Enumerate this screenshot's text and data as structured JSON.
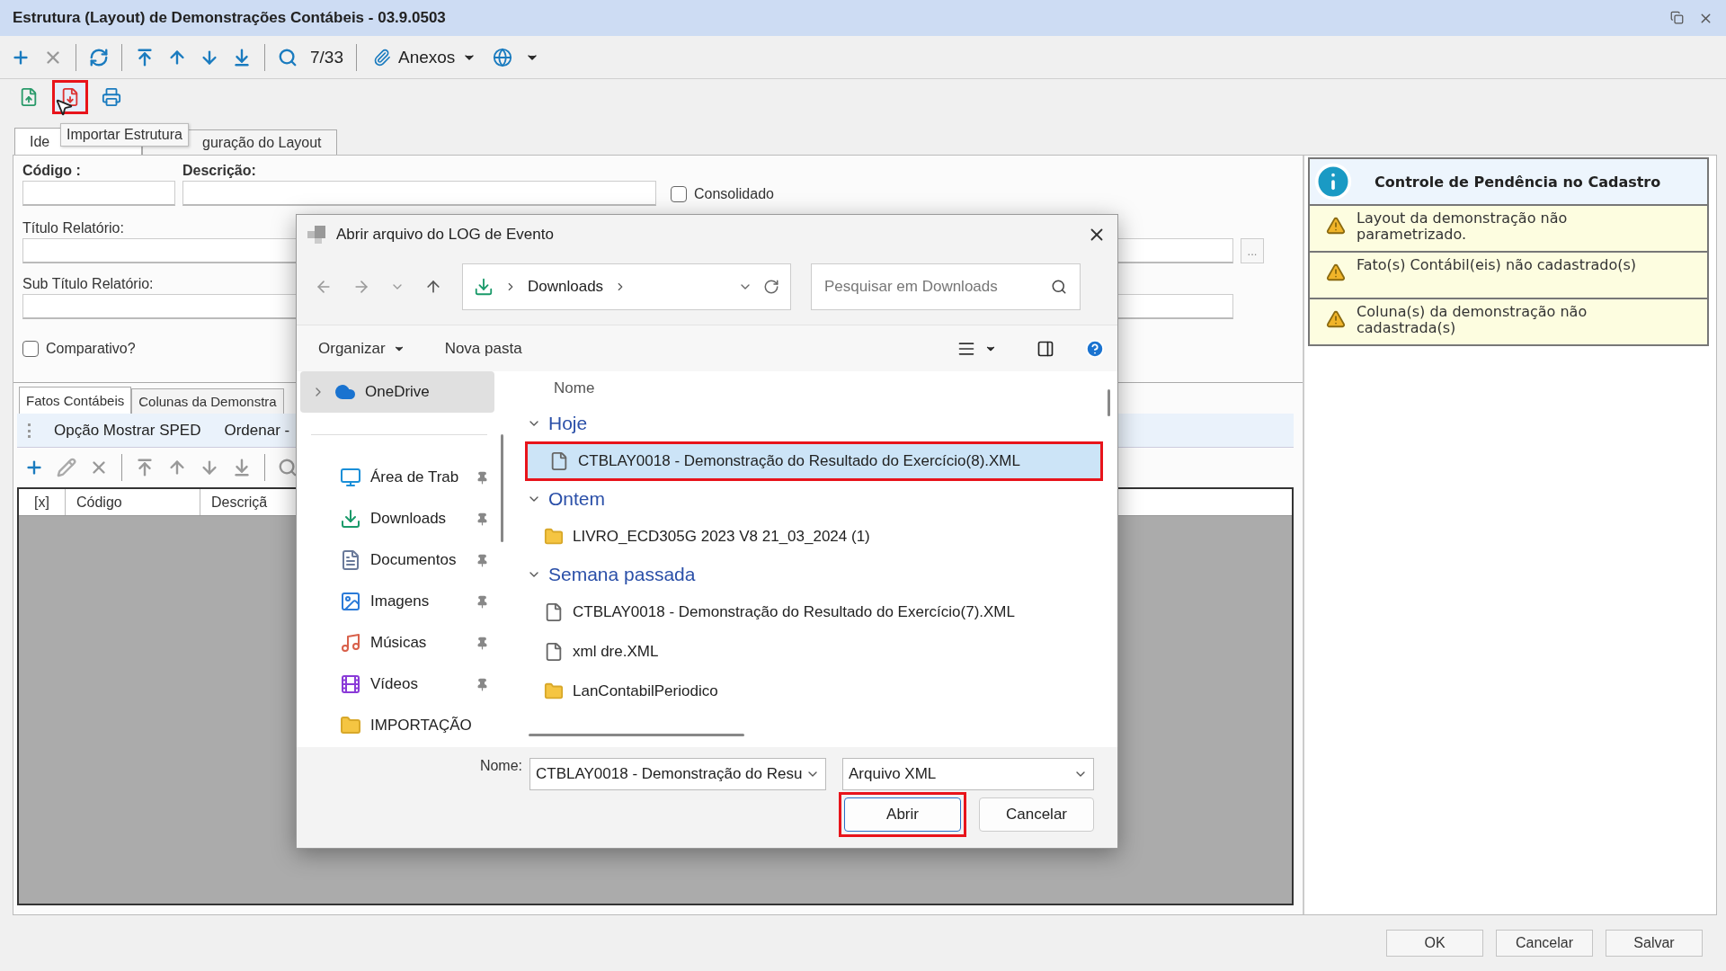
{
  "window": {
    "title": "Estrutura (Layout) de Demonstrações Contábeis - 03.9.0503"
  },
  "toolbar": {
    "record_counter": "7/33",
    "attachments_label": "Anexos"
  },
  "secondary_toolbar": [
    {
      "kind": "export",
      "highlighted": false
    },
    {
      "kind": "import",
      "highlighted": true
    },
    {
      "kind": "print",
      "highlighted": false
    }
  ],
  "tooltip": "Importar Estrutura",
  "tabs": [
    {
      "label": "Ide",
      "selected": true
    },
    {
      "label": "guração do Layout",
      "selected": false
    }
  ],
  "form": {
    "code_label": "Código :",
    "description_label": "Descrição:",
    "consolidated": {
      "label": "Consolidado",
      "checked": false
    },
    "report_title_label": "Título  Relatório:",
    "browse_button": "...",
    "report_subtitle_label": "Sub Título Relatório:",
    "comparative": {
      "label": "Comparativo?",
      "checked": false
    }
  },
  "detail_tabs": [
    {
      "label": "Fatos Contábeis",
      "selected": true
    },
    {
      "label": "Colunas da Demonstra",
      "selected": false
    }
  ],
  "detail_menu": [
    "Opção Mostrar SPED",
    "Ordenar -"
  ],
  "grid": {
    "columns": [
      "[x]",
      "Código",
      "Descriçã"
    ]
  },
  "pending_panel": {
    "title": "Controle de Pendência no Cadastro",
    "items": [
      "Layout da demonstração não parametrizado.",
      "Fato(s) Contábil(eis) não cadastrado(s)",
      "Coluna(s) da demonstração não cadastrada(s)"
    ]
  },
  "dialog": {
    "title": "Abrir arquivo do LOG de Evento",
    "path": "Downloads",
    "search_placeholder": "Pesquisar em Downloads",
    "organize": "Organizar",
    "new_folder": "Nova pasta",
    "nav": [
      {
        "label": "OneDrive",
        "kind": "cloud",
        "selected": true,
        "pinned": false
      },
      {
        "label": "Área de Trab",
        "kind": "desktop",
        "selected": false,
        "pinned": true
      },
      {
        "label": "Downloads",
        "kind": "downloads",
        "selected": false,
        "pinned": true
      },
      {
        "label": "Documentos",
        "kind": "documents",
        "selected": false,
        "pinned": true
      },
      {
        "label": "Imagens",
        "kind": "pictures",
        "selected": false,
        "pinned": true
      },
      {
        "label": "Músicas",
        "kind": "music",
        "selected": false,
        "pinned": true
      },
      {
        "label": "Vídeos",
        "kind": "videos",
        "selected": false,
        "pinned": true
      },
      {
        "label": "IMPORTAÇÃO",
        "kind": "folder",
        "selected": false,
        "pinned": false
      }
    ],
    "column_header": "Nome",
    "groups": [
      {
        "label": "Hoje",
        "expanded": true,
        "files": [
          {
            "name": "CTBLAY0018 - Demonstração do Resultado do Exercício(8).XML",
            "kind": "file",
            "selected": true,
            "highlighted": true
          }
        ]
      },
      {
        "label": "Ontem",
        "expanded": true,
        "files": [
          {
            "name": "LIVRO_ECD305G 2023 V8 21_03_2024 (1)",
            "kind": "folder",
            "selected": false,
            "highlighted": false
          }
        ]
      },
      {
        "label": "Semana passada",
        "expanded": true,
        "files": [
          {
            "name": "CTBLAY0018 - Demonstração do Resultado do Exercício(7).XML",
            "kind": "file",
            "selected": false,
            "highlighted": false
          },
          {
            "name": "xml dre.XML",
            "kind": "file",
            "selected": false,
            "highlighted": false
          },
          {
            "name": "LanContabilPeriodico",
            "kind": "folder",
            "selected": false,
            "highlighted": false
          }
        ]
      }
    ],
    "name_label": "Nome:",
    "name_value": "CTBLAY0018 - Demonstração do Resu",
    "file_type": "Arquivo XML",
    "buttons": [
      {
        "label": "Abrir",
        "kind": "primary",
        "highlighted": true
      },
      {
        "label": "Cancelar",
        "kind": "secondary",
        "highlighted": false
      }
    ]
  },
  "footer_buttons": [
    "OK",
    "Cancelar",
    "Salvar"
  ]
}
